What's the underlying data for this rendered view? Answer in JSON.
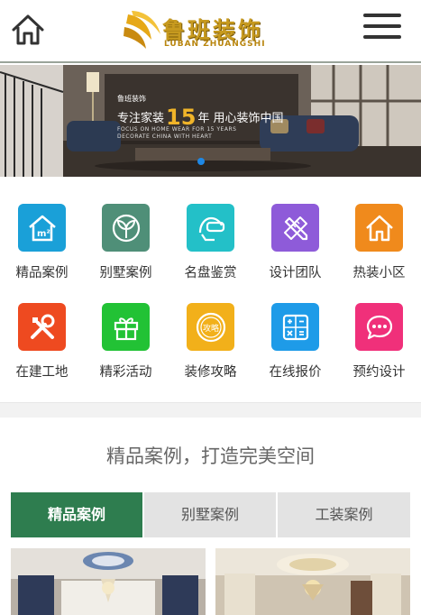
{
  "header": {
    "home_icon": "home-icon",
    "menu_icon": "menu-icon",
    "logo_cn": "鲁班装饰",
    "logo_en": "LUBAN ZHUANGSHI"
  },
  "banner": {
    "brand": "鲁班装饰",
    "slogan_pre": "专注家装",
    "slogan_num": "15",
    "slogan_post": "年  用心装饰中国",
    "en_line1": "FOCUS ON HOME WEAR FOR 15 YEARS",
    "en_line2": "DECORATE CHINA WITH HEART"
  },
  "nav": [
    {
      "label": "精品案例",
      "icon": "house-m2-icon",
      "color": "#1aa0d8"
    },
    {
      "label": "别墅案例",
      "icon": "leaf-icon",
      "color": "#4f8f78"
    },
    {
      "label": "名盘鉴赏",
      "icon": "vr-headset-icon",
      "color": "#23c0c8"
    },
    {
      "label": "设计团队",
      "icon": "pencil-ruler-icon",
      "color": "#8e5bd9"
    },
    {
      "label": "热装小区",
      "icon": "home-outline-icon",
      "color": "#f08a1c"
    },
    {
      "label": "在建工地",
      "icon": "tools-icon",
      "color": "#ee4a20"
    },
    {
      "label": "精彩活动",
      "icon": "gift-icon",
      "color": "#22c235"
    },
    {
      "label": "装修攻略",
      "icon": "guide-badge-icon",
      "color": "#f2b01a"
    },
    {
      "label": "在线报价",
      "icon": "calculator-icon",
      "color": "#1e9be8"
    },
    {
      "label": "预约设计",
      "icon": "chat-bubble-icon",
      "color": "#f0307a"
    }
  ],
  "guide_badge_text": "攻略",
  "section": {
    "title": "精品案例，打造完美空间"
  },
  "tabs": [
    {
      "label": "精品案例",
      "active": true
    },
    {
      "label": "别墅案例",
      "active": false
    },
    {
      "label": "工装案例",
      "active": false
    }
  ]
}
